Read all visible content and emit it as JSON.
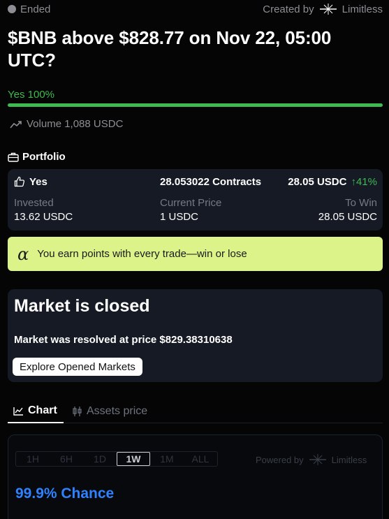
{
  "status": {
    "label": "Ended",
    "created_by_label": "Created by",
    "creator": "Limitless"
  },
  "market": {
    "title": "$BNB above $828.77 on Nov 22, 05:00 UTC?",
    "outcome_label": "Yes 100%",
    "outcome_probability": 1.0,
    "volume": "Volume 1,088 USDC"
  },
  "portfolio": {
    "heading": "Portfolio",
    "side": "Yes",
    "contracts": "28.053022 Contracts",
    "payout": "28.05 USDC",
    "change": "41%",
    "invested_label": "Invested",
    "invested_value": "13.62 USDC",
    "current_price_label": "Current Price",
    "current_price_value": "1 USDC",
    "to_win_label": "To Win",
    "to_win_value": "28.05 USDC"
  },
  "points_banner": {
    "text": "You earn points with every trade—win or lose"
  },
  "closed": {
    "title": "Market is closed",
    "text": "Market was resolved at price $829.38310638",
    "button": "Explore Opened Markets"
  },
  "tabs": [
    {
      "label": "Chart",
      "icon": "line-chart-icon",
      "active": true
    },
    {
      "label": "Assets price",
      "icon": "candlestick-icon",
      "active": false
    }
  ],
  "chart": {
    "ranges": [
      "1H",
      "6H",
      "1D",
      "1W",
      "1M",
      "ALL"
    ],
    "active_range": "1W",
    "powered_by_label": "Powered by",
    "powered_by_brand": "Limitless",
    "chance": "99.9% Chance"
  },
  "colors": {
    "background": "#050505",
    "card": "#151a24",
    "yes_green": "#3fb950",
    "banner": "#dcf38a",
    "chance_blue": "#2f82ff"
  }
}
